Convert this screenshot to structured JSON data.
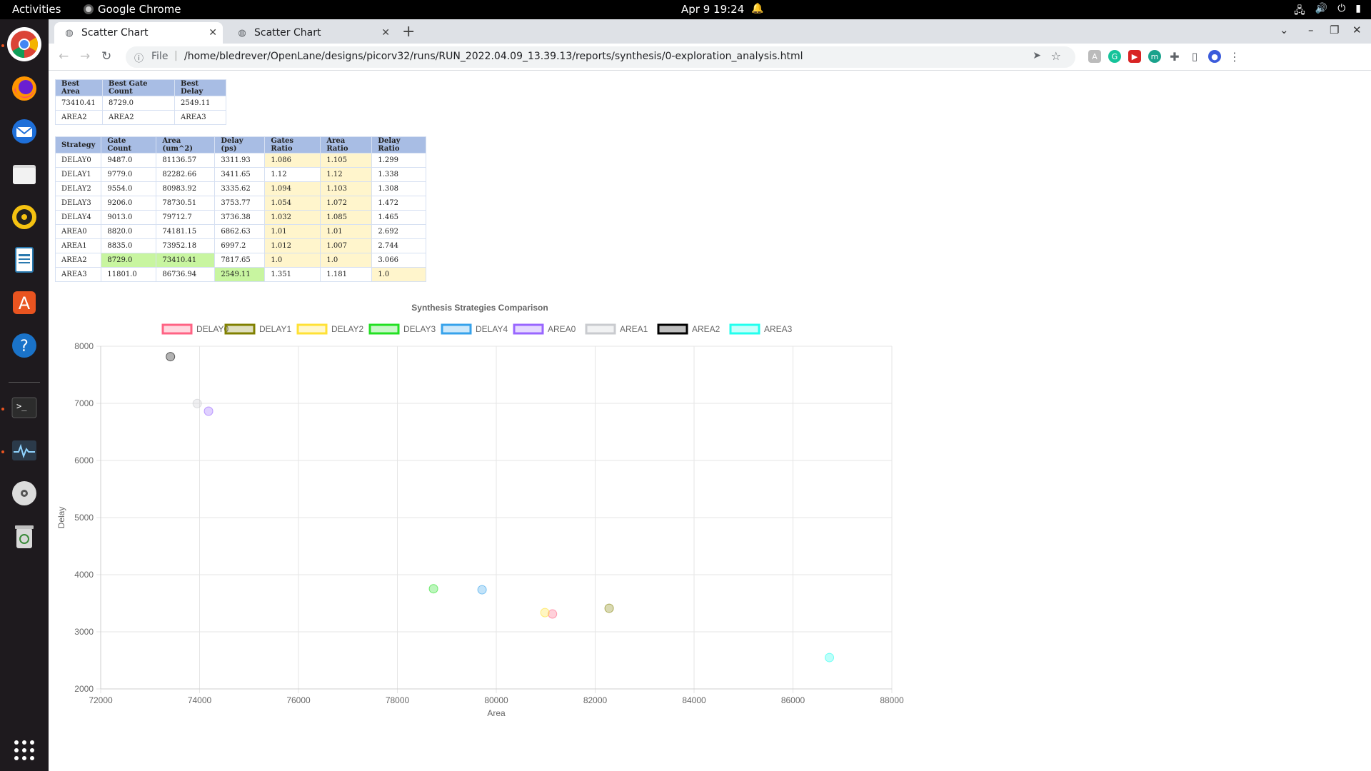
{
  "topbar": {
    "activities": "Activities",
    "app_name": "Google Chrome",
    "clock": "Apr 9  19:24"
  },
  "dock": {
    "items": [
      "chrome-icon",
      "firefox-icon",
      "thunderbird-icon",
      "files-icon",
      "rhythmbox-icon",
      "writer-icon",
      "software-icon",
      "help-icon",
      "terminal-icon",
      "system-monitor-icon",
      "disc-icon",
      "trash-icon",
      "apps-grid-icon"
    ]
  },
  "browser": {
    "tabs": [
      {
        "label": "Scatter Chart"
      },
      {
        "label": "Scatter Chart"
      }
    ],
    "url_protocol": "File",
    "url": "/home/bledrever/OpenLane/designs/picorv32/runs/RUN_2022.04.09_13.39.13/reports/synthesis/0-exploration_analysis.html"
  },
  "best_table": {
    "headers": [
      "Best Area",
      "Best Gate Count",
      "Best Delay"
    ],
    "rows": [
      [
        "73410.41",
        "8729.0",
        "2549.11"
      ],
      [
        "AREA2",
        "AREA2",
        "AREA3"
      ]
    ]
  },
  "strategy_table": {
    "headers": [
      "Strategy",
      "Gate Count",
      "Area (um^2)",
      "Delay (ps)",
      "Gates Ratio",
      "Area Ratio",
      "Delay Ratio"
    ],
    "rows": [
      [
        "DELAY0",
        "9487.0",
        "81136.57",
        "3311.93",
        "1.086",
        "1.105",
        "1.299"
      ],
      [
        "DELAY1",
        "9779.0",
        "82282.66",
        "3411.65",
        "1.12",
        "1.12",
        "1.338"
      ],
      [
        "DELAY2",
        "9554.0",
        "80983.92",
        "3335.62",
        "1.094",
        "1.103",
        "1.308"
      ],
      [
        "DELAY3",
        "9206.0",
        "78730.51",
        "3753.77",
        "1.054",
        "1.072",
        "1.472"
      ],
      [
        "DELAY4",
        "9013.0",
        "79712.7",
        "3736.38",
        "1.032",
        "1.085",
        "1.465"
      ],
      [
        "AREA0",
        "8820.0",
        "74181.15",
        "6862.63",
        "1.01",
        "1.01",
        "2.692"
      ],
      [
        "AREA1",
        "8835.0",
        "73952.18",
        "6997.2",
        "1.012",
        "1.007",
        "2.744"
      ],
      [
        "AREA2",
        "8729.0",
        "73410.41",
        "7817.65",
        "1.0",
        "1.0",
        "3.066"
      ],
      [
        "AREA3",
        "11801.0",
        "86736.94",
        "2549.11",
        "1.351",
        "1.181",
        "1.0"
      ]
    ],
    "highlight": [
      [
        false,
        false,
        false,
        false,
        true,
        true,
        false
      ],
      [
        false,
        false,
        false,
        false,
        false,
        true,
        false
      ],
      [
        false,
        false,
        false,
        false,
        true,
        true,
        false
      ],
      [
        false,
        false,
        false,
        false,
        true,
        true,
        false
      ],
      [
        false,
        false,
        false,
        false,
        true,
        true,
        false
      ],
      [
        false,
        false,
        false,
        false,
        true,
        true,
        false
      ],
      [
        false,
        false,
        false,
        false,
        true,
        true,
        false
      ],
      [
        false,
        "best",
        "best",
        false,
        true,
        true,
        false
      ],
      [
        false,
        false,
        false,
        "best",
        false,
        false,
        true
      ]
    ]
  },
  "chart_data": {
    "type": "scatter",
    "title": "Synthesis Strategies Comparison",
    "xlabel": "Area",
    "ylabel": "Delay",
    "xlim": [
      72000,
      88000
    ],
    "ylim": [
      2000,
      8000
    ],
    "xticks": [
      72000,
      74000,
      76000,
      78000,
      80000,
      82000,
      84000,
      86000,
      88000
    ],
    "yticks": [
      2000,
      3000,
      4000,
      5000,
      6000,
      7000,
      8000
    ],
    "grid": true,
    "legend_position": "top",
    "series": [
      {
        "name": "DELAY0",
        "color": "#ff6384",
        "x": 81136.57,
        "y": 3311.93
      },
      {
        "name": "DELAY1",
        "color": "#808000",
        "x": 82282.66,
        "y": 3411.65
      },
      {
        "name": "DELAY2",
        "color": "#ffe135",
        "x": 80983.92,
        "y": 3335.62
      },
      {
        "name": "DELAY3",
        "color": "#22e022",
        "x": 78730.51,
        "y": 3753.77
      },
      {
        "name": "DELAY4",
        "color": "#36a2eb",
        "x": 79712.7,
        "y": 3736.38
      },
      {
        "name": "AREA0",
        "color": "#9966ff",
        "x": 74181.15,
        "y": 6862.63
      },
      {
        "name": "AREA1",
        "color": "#c9cbcf",
        "x": 73952.18,
        "y": 6997.2
      },
      {
        "name": "AREA2",
        "color": "#000000",
        "x": 73410.41,
        "y": 7817.65
      },
      {
        "name": "AREA3",
        "color": "#22ffee",
        "x": 86736.94,
        "y": 2549.11
      }
    ]
  }
}
